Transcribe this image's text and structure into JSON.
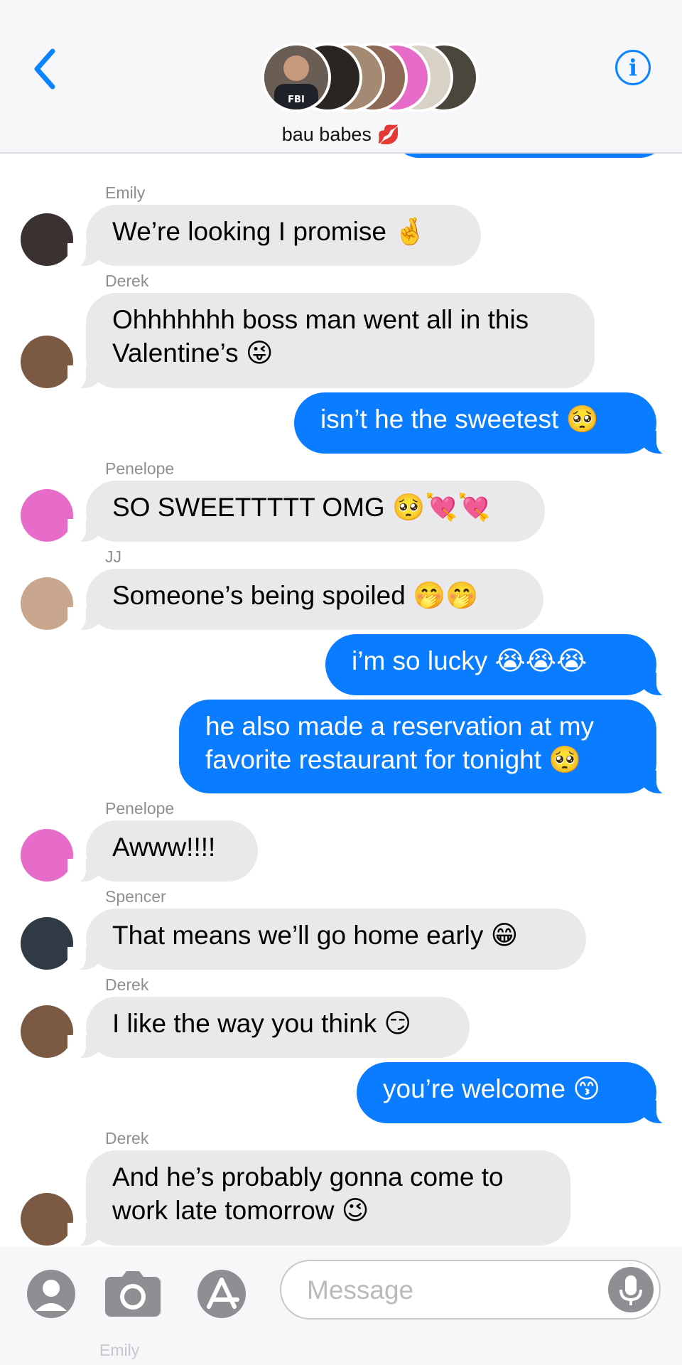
{
  "header": {
    "group_name": "bau babes",
    "title_emoji": "💋",
    "info_label": "i"
  },
  "messages": [
    {
      "sender": "Emily",
      "direction": "incoming",
      "text": "We’re looking I promise 🤞",
      "avatar_color": "#3a3230"
    },
    {
      "sender": "Derek",
      "direction": "incoming",
      "text": "Ohhhhhhh boss man went all in this\nValentine’s 😜",
      "avatar_color": "#7a5a42"
    },
    {
      "sender": "",
      "direction": "outgoing",
      "text": "isn’t he the sweetest 🥺"
    },
    {
      "sender": "Penelope",
      "direction": "incoming",
      "text": "SO SWEETTTTT OMG 🥺💘💘",
      "avatar_color": "#e76cc9"
    },
    {
      "sender": "JJ",
      "direction": "incoming",
      "text": "Someone’s being spoiled 🤭🤭",
      "avatar_color": "#c9a78f"
    },
    {
      "sender": "",
      "direction": "outgoing",
      "text": "i’m so lucky 😭😭😭"
    },
    {
      "sender": "",
      "direction": "outgoing",
      "text": "he also made a reservation at my\nfavorite restaurant for tonight 🥺"
    },
    {
      "sender": "Penelope",
      "direction": "incoming",
      "text": "Awww!!!!",
      "avatar_color": "#e76cc9"
    },
    {
      "sender": "Spencer",
      "direction": "incoming",
      "text": "That means we’ll go home early 😁",
      "avatar_color": "#2f3a44"
    },
    {
      "sender": "Derek",
      "direction": "incoming",
      "text": "I like the way you think 😏",
      "avatar_color": "#7a5a42"
    },
    {
      "sender": "",
      "direction": "outgoing",
      "text": "you’re welcome 😙"
    },
    {
      "sender": "Derek",
      "direction": "incoming",
      "text": "And he’s probably gonna come to\nwork late tomorrow 😉",
      "avatar_color": "#7a5a42"
    }
  ],
  "input": {
    "placeholder": "Message",
    "under_text": "Emily"
  },
  "icons": {
    "back": "chevron-left-icon",
    "info": "info-icon",
    "contact": "contact-icon",
    "camera": "camera-icon",
    "appstore": "app-store-icon",
    "mic": "microphone-icon"
  },
  "colors": {
    "accent": "#0a84ff",
    "outgoing_bubble": "#0a7cff",
    "incoming_bubble": "#e9e9eb",
    "sender_label": "#8e8e93"
  }
}
